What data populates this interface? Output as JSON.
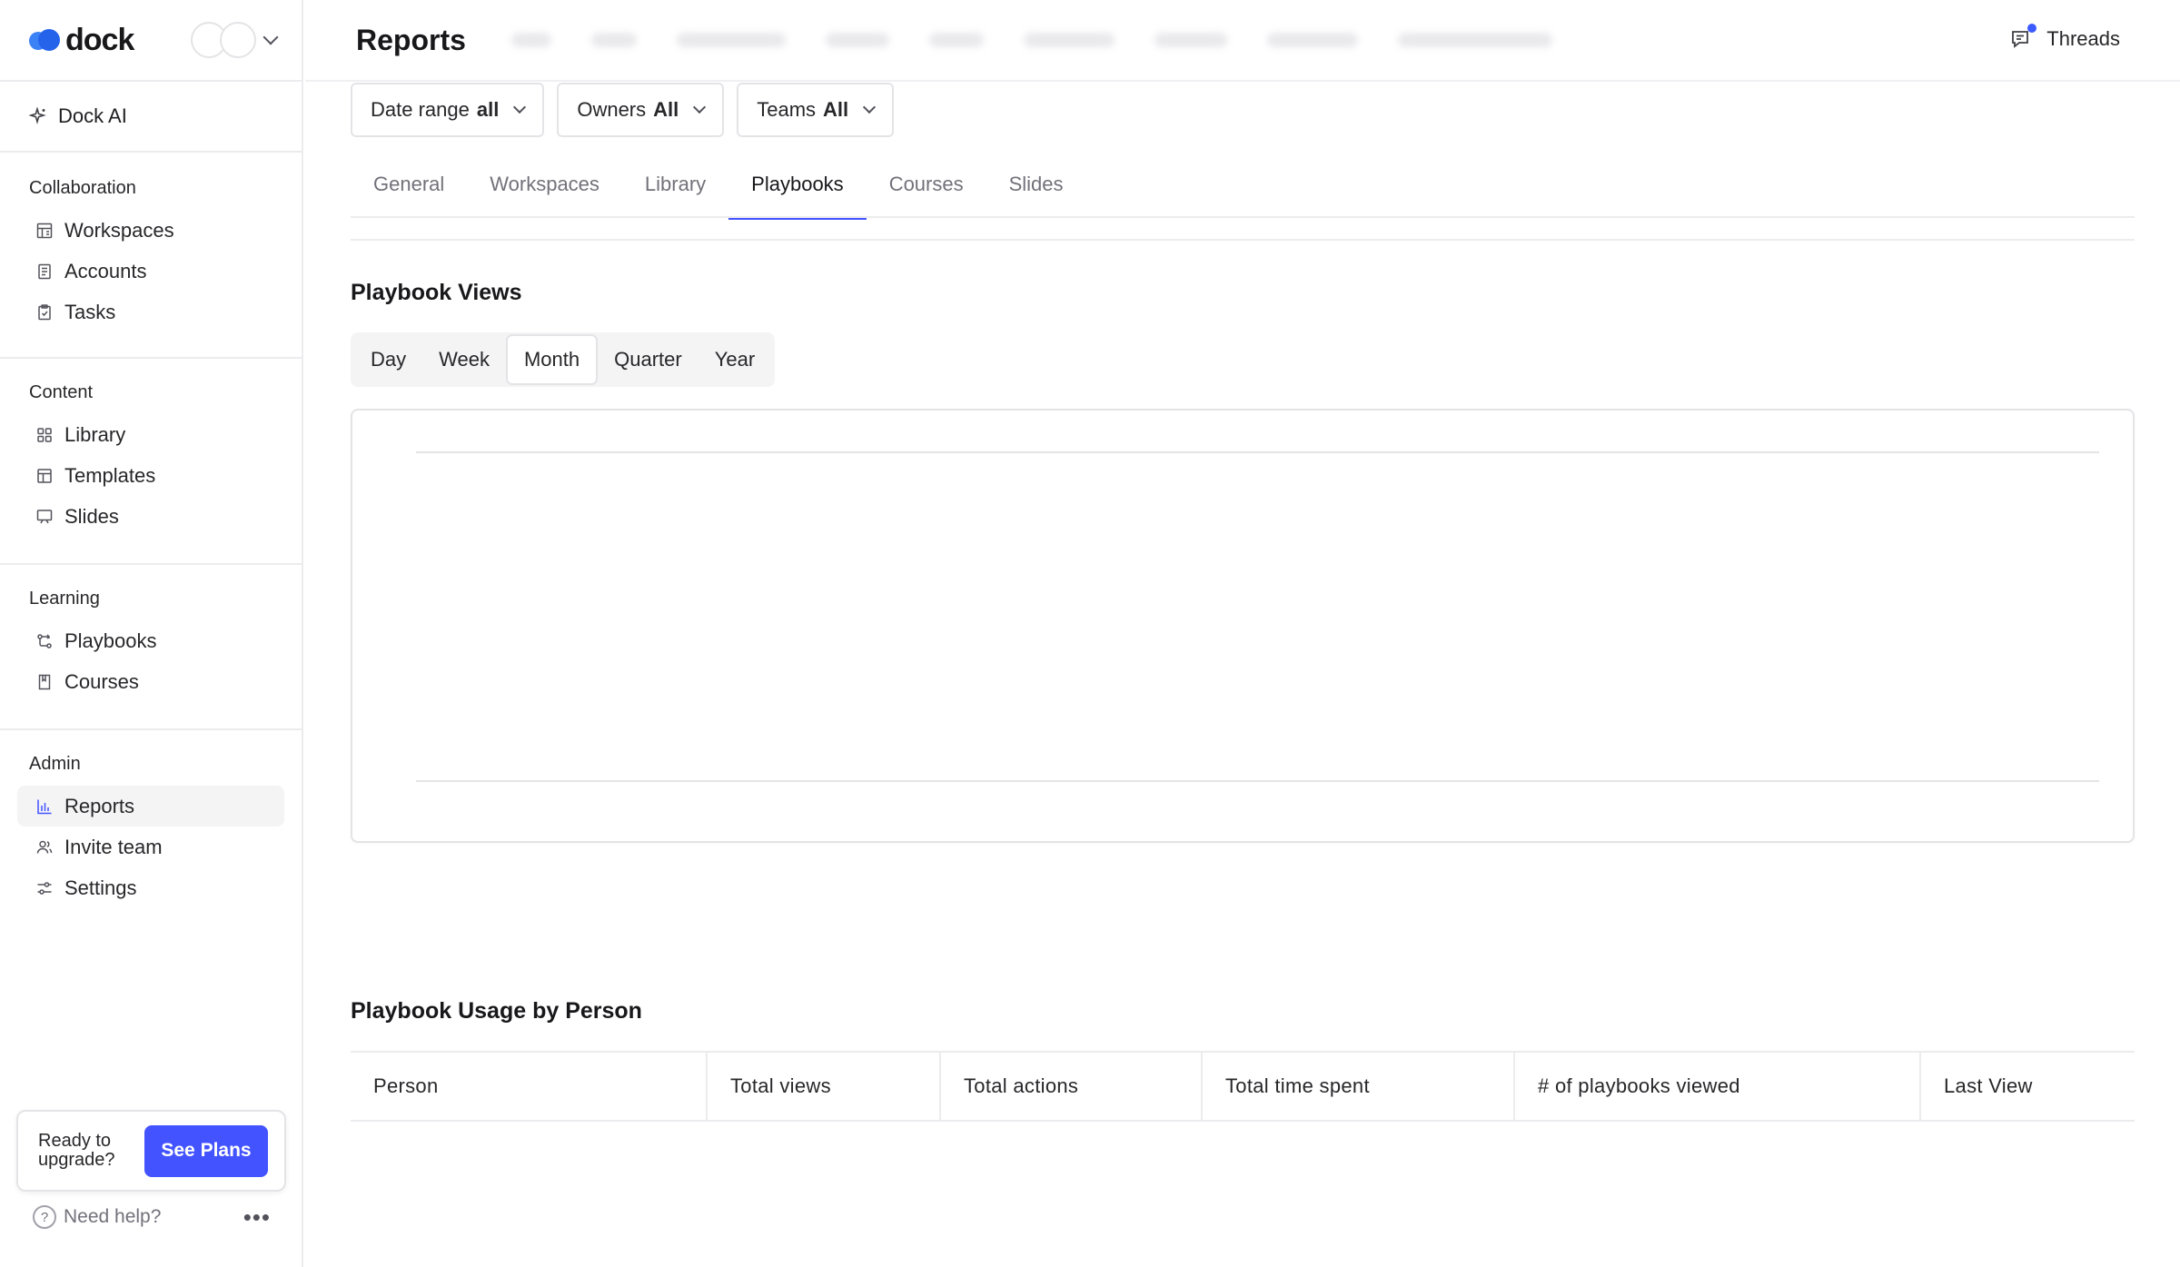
{
  "brand": {
    "name": "dock"
  },
  "sidebar": {
    "ai": {
      "label": "Dock AI",
      "icon": "sparkle-icon"
    },
    "sections": [
      {
        "title": "Collaboration",
        "items": [
          {
            "label": "Workspaces",
            "icon": "workspace-icon"
          },
          {
            "label": "Accounts",
            "icon": "accounts-icon"
          },
          {
            "label": "Tasks",
            "icon": "clipboard-icon"
          }
        ]
      },
      {
        "title": "Content",
        "items": [
          {
            "label": "Library",
            "icon": "grid-icon"
          },
          {
            "label": "Templates",
            "icon": "template-icon"
          },
          {
            "label": "Slides",
            "icon": "presentation-icon"
          }
        ]
      },
      {
        "title": "Learning",
        "items": [
          {
            "label": "Playbooks",
            "icon": "playbook-icon"
          },
          {
            "label": "Courses",
            "icon": "book-icon"
          }
        ]
      },
      {
        "title": "Admin",
        "items": [
          {
            "label": "Reports",
            "icon": "bar-chart-icon",
            "active": true
          },
          {
            "label": "Invite team",
            "icon": "users-icon"
          },
          {
            "label": "Settings",
            "icon": "sliders-icon"
          }
        ]
      }
    ],
    "upgrade": {
      "text": "Ready to upgrade?",
      "button": "See Plans"
    },
    "help": {
      "label": "Need help?"
    }
  },
  "header": {
    "title": "Reports",
    "threads_label": "Threads"
  },
  "filters": [
    {
      "label": "Date range",
      "value": "all"
    },
    {
      "label": "Owners",
      "value": "All"
    },
    {
      "label": "Teams",
      "value": "All"
    }
  ],
  "tabs": [
    {
      "label": "General"
    },
    {
      "label": "Workspaces"
    },
    {
      "label": "Library"
    },
    {
      "label": "Playbooks",
      "active": true
    },
    {
      "label": "Courses"
    },
    {
      "label": "Slides"
    }
  ],
  "views": {
    "title": "Playbook Views",
    "periods": [
      "Day",
      "Week",
      "Month",
      "Quarter",
      "Year"
    ],
    "selected_period": "Month"
  },
  "usage": {
    "title": "Playbook Usage by Person",
    "columns": [
      "Person",
      "Total views",
      "Total actions",
      "Total time spent",
      "# of playbooks viewed",
      "Last View"
    ]
  },
  "colors": {
    "accent": "#4353ff",
    "border": "#e4e4e7",
    "brand_blue": "#2563eb"
  }
}
